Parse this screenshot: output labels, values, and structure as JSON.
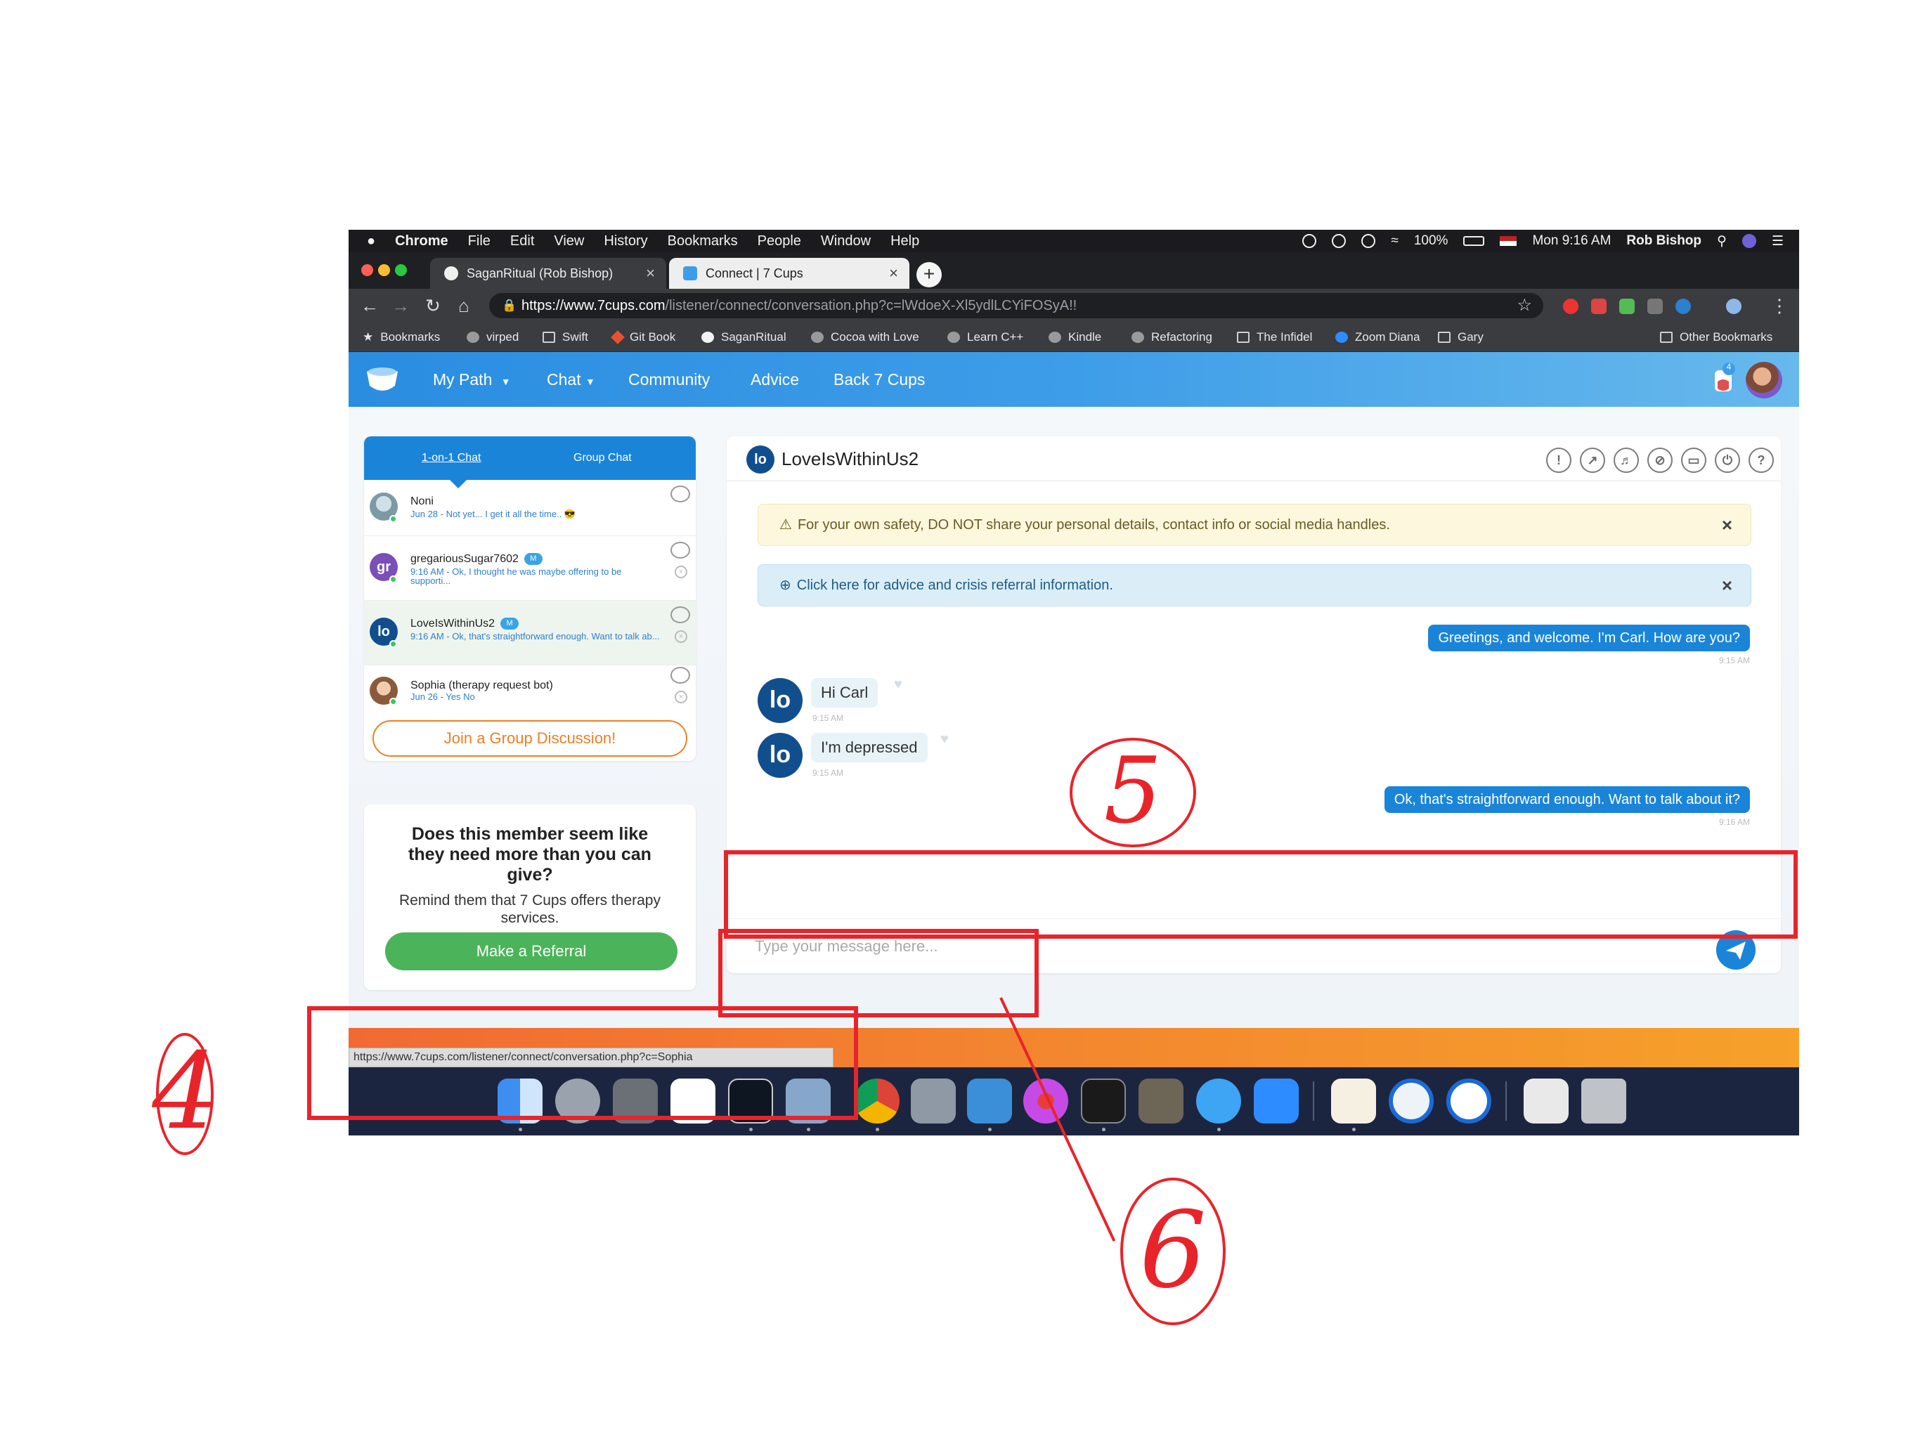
{
  "menubar": {
    "app": "Chrome",
    "items": [
      "File",
      "Edit",
      "View",
      "History",
      "Bookmarks",
      "People",
      "Window",
      "Help"
    ],
    "battery": "100%",
    "clock": "Mon 9:16 AM",
    "user": "Rob Bishop"
  },
  "tabs": [
    {
      "title": "SaganRitual (Rob Bishop)"
    },
    {
      "title": "Connect | 7 Cups"
    }
  ],
  "omnibox": {
    "url_main": "https://www.7cups.com",
    "url_rest": "/listener/connect/conversation.php?c=lWdoeX-Xl5ydlLCYiFOSyA!!"
  },
  "bookmarks": {
    "items": [
      {
        "label": "Bookmarks",
        "icon": "star-icon"
      },
      {
        "label": "virped",
        "icon": "globe-icon"
      },
      {
        "label": "Swift",
        "icon": "folder-icon"
      },
      {
        "label": "Git Book",
        "icon": "git-icon"
      },
      {
        "label": "SaganRitual",
        "icon": "github-icon"
      },
      {
        "label": "Cocoa with Love",
        "icon": "globe-icon"
      },
      {
        "label": "Learn C++",
        "icon": "globe-icon"
      },
      {
        "label": "Kindle",
        "icon": "globe-icon"
      },
      {
        "label": "Refactoring",
        "icon": "globe-icon"
      },
      {
        "label": "The Infidel",
        "icon": "folder-icon"
      },
      {
        "label": "Zoom Diana",
        "icon": "zoom-icon"
      },
      {
        "label": "Gary",
        "icon": "folder-icon"
      }
    ],
    "other": "Other Bookmarks"
  },
  "nav": {
    "my_path": "My Path",
    "chat": "Chat",
    "community": "Community",
    "advice": "Advice",
    "back": "Back 7 Cups",
    "notif_count": "4"
  },
  "sidebar": {
    "tab_one": "1-on-1 Chat",
    "tab_group": "Group Chat",
    "conversations": [
      {
        "name": "Noni",
        "preview": "Jun 28 - Not yet... I get it all the time.. 😎",
        "initials": ""
      },
      {
        "name": "gregariousSugar7602",
        "badge": "M",
        "preview": "9:16 AM - Ok, I thought he was maybe offering to be supporti...",
        "initials": "gr"
      },
      {
        "name": "LoveIsWithinUs2",
        "badge": "M",
        "preview": "9:16 AM - Ok, that's straightforward enough. Want to talk ab...",
        "initials": "lo"
      },
      {
        "name": "Sophia (therapy request bot)",
        "preview": "Jun 26 - Yes No",
        "initials": ""
      }
    ],
    "join_button": "Join a Group Discussion!"
  },
  "referral": {
    "question": "Does this member seem like they need more than you can give?",
    "subtext": "Remind them that 7 Cups offers therapy services.",
    "button": "Make a Referral"
  },
  "chat": {
    "partner": "LoveIsWithinUs2",
    "partner_initials": "lo",
    "safety_alert": "For your own safety, DO NOT share your personal details, contact info or social media handles.",
    "crisis_alert": "Click here for advice and crisis referral information.",
    "messages": [
      {
        "from": "me",
        "text": "Greetings, and welcome. I'm Carl. How are you?",
        "time": "9:15 AM"
      },
      {
        "from": "them",
        "text": "Hi Carl",
        "time": "9:15 AM"
      },
      {
        "from": "them",
        "text": "I'm depressed",
        "time": "9:15 AM"
      },
      {
        "from": "me",
        "text": "Ok, that's straightforward enough. Want to talk about it?",
        "time": "9:16 AM"
      }
    ],
    "input_placeholder": "Type your message here..."
  },
  "footer": {
    "status_url": "https://www.7cups.com/listener/connect/conversation.php?c=Sophia"
  },
  "annotations": {
    "label_4": "4",
    "label_5": "5",
    "label_6": "6"
  },
  "colors": {
    "brand_blue": "#1a85d8",
    "accent_orange": "#ef7f22",
    "referral_green": "#4bb35a",
    "annotation_red": "#e8242b"
  }
}
